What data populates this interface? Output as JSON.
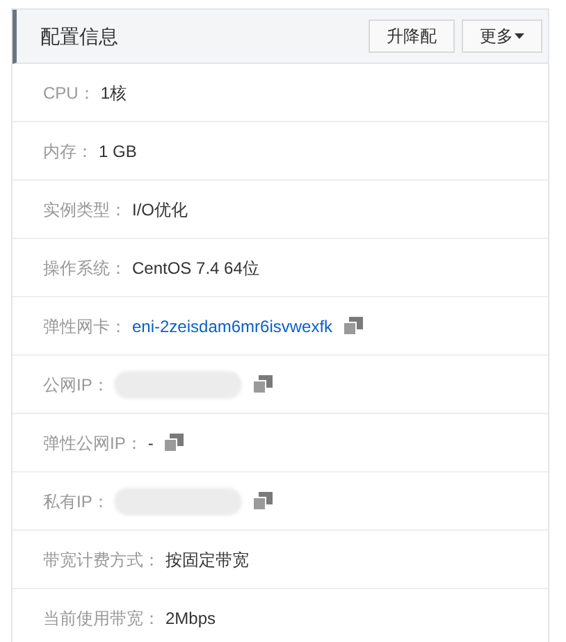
{
  "panel": {
    "title": "配置信息",
    "buttons": [
      {
        "label": "升降配",
        "dropdown": false
      },
      {
        "label": "更多",
        "dropdown": true
      }
    ]
  },
  "rows": [
    {
      "label": "CPU：",
      "kind": "text",
      "value": "1核",
      "copyable": false
    },
    {
      "label": "内存：",
      "kind": "text",
      "value": "1 GB",
      "copyable": false
    },
    {
      "label": "实例类型：",
      "kind": "text",
      "value": "I/O优化",
      "copyable": false
    },
    {
      "label": "操作系统：",
      "kind": "text",
      "value": "CentOS 7.4 64位",
      "copyable": false
    },
    {
      "label": "弹性网卡：",
      "kind": "link",
      "value": "eni-2zeisdam6mr6isvwexfk",
      "copyable": true
    },
    {
      "label": "公网IP：",
      "kind": "redacted",
      "copyable": true
    },
    {
      "label": "弹性公网IP：",
      "kind": "text",
      "value": "-",
      "copyable": true
    },
    {
      "label": "私有IP：",
      "kind": "redacted",
      "copyable": true
    },
    {
      "label": "带宽计费方式：",
      "kind": "text",
      "value": "按固定带宽",
      "copyable": false
    },
    {
      "label": "当前使用带宽：",
      "kind": "text",
      "value": "2Mbps",
      "copyable": false
    }
  ]
}
